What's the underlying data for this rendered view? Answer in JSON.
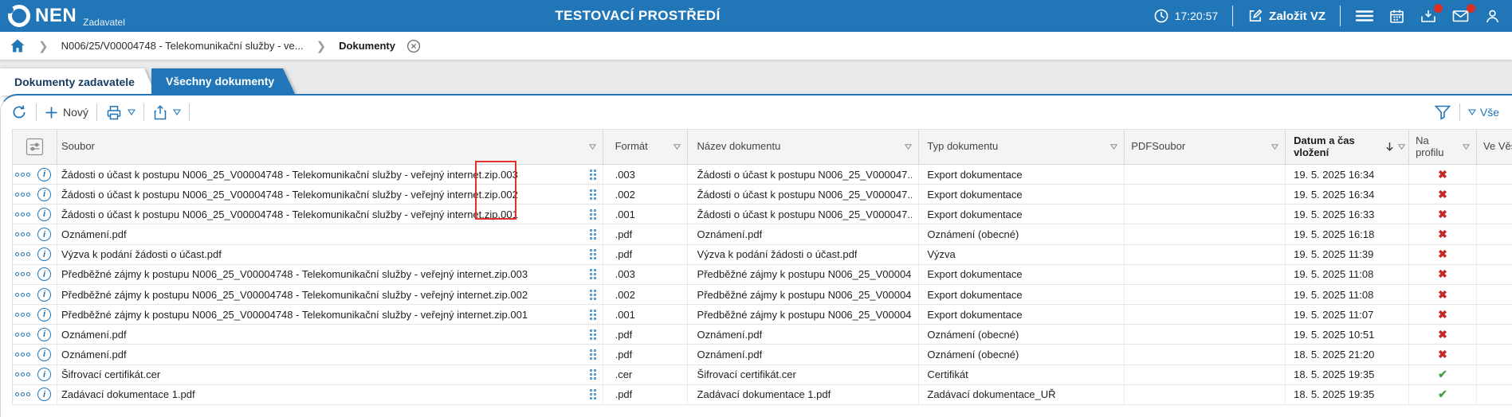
{
  "app": {
    "logo_text": "NEN",
    "logo_subtext": "Zadavatel",
    "environment_title": "TESTOVACÍ PROSTŘEDÍ",
    "time": "17:20:57",
    "create_vz_label": "Založit VZ"
  },
  "breadcrumb": {
    "procedure": "N006/25/V00004748 - Telekomunikační služby - ve...",
    "current": "Dokumenty"
  },
  "tabs": {
    "active": "Dokumenty zadavatele",
    "inactive": "Všechny dokumenty"
  },
  "toolbar": {
    "new_label": "Nový",
    "filter_all_label": "Vše"
  },
  "table": {
    "headers": {
      "soubor": "Soubor",
      "format": "Formát",
      "nazev": "Název dokumentu",
      "typ": "Typ dokumentu",
      "pdfsoubor": "PDFSoubor",
      "datum": "Datum a čas vložení",
      "na_profilu": "Na profilu",
      "ve_vestniku": "Ve Věst"
    },
    "rows": [
      {
        "soubor": "Žádosti o účast k postupu N006_25_V00004748 - Telekomunikační služby - veřejný internet.zip.003",
        "format": ".003",
        "nazev": "Žádosti o účast k postupu N006_25_V000047...",
        "typ": "Export dokumentace",
        "pdfsoubor": "",
        "datum": "19. 5. 2025 16:34",
        "na_profilu": "x-icon",
        "ve_vestniku": ""
      },
      {
        "soubor": "Žádosti o účast k postupu N006_25_V00004748 - Telekomunikační služby - veřejný internet.zip.002",
        "format": ".002",
        "nazev": "Žádosti o účast k postupu N006_25_V000047...",
        "typ": "Export dokumentace",
        "pdfsoubor": "",
        "datum": "19. 5. 2025 16:34",
        "na_profilu": "x-icon",
        "ve_vestniku": ""
      },
      {
        "soubor": "Žádosti o účast k postupu N006_25_V00004748 - Telekomunikační služby - veřejný internet.zip.001",
        "format": ".001",
        "nazev": "Žádosti o účast k postupu N006_25_V000047...",
        "typ": "Export dokumentace",
        "pdfsoubor": "",
        "datum": "19. 5. 2025 16:33",
        "na_profilu": "x-icon",
        "ve_vestniku": ""
      },
      {
        "soubor": "Oznámení.pdf",
        "format": ".pdf",
        "nazev": "Oznámení.pdf",
        "typ": "Oznámení (obecné)",
        "pdfsoubor": "",
        "datum": "19. 5. 2025 16:18",
        "na_profilu": "x-icon",
        "ve_vestniku": ""
      },
      {
        "soubor": "Výzva k podání žádosti o účast.pdf",
        "format": ".pdf",
        "nazev": "Výzva k podání žádosti o účast.pdf",
        "typ": "Výzva",
        "pdfsoubor": "",
        "datum": "19. 5. 2025 11:39",
        "na_profilu": "x-icon",
        "ve_vestniku": ""
      },
      {
        "soubor": "Předběžné zájmy k postupu N006_25_V00004748 - Telekomunikační služby - veřejný internet.zip.003",
        "format": ".003",
        "nazev": "Předběžné zájmy k postupu N006_25_V00004...",
        "typ": "Export dokumentace",
        "pdfsoubor": "",
        "datum": "19. 5. 2025 11:08",
        "na_profilu": "x-icon",
        "ve_vestniku": ""
      },
      {
        "soubor": "Předběžné zájmy k postupu N006_25_V00004748 - Telekomunikační služby - veřejný internet.zip.002",
        "format": ".002",
        "nazev": "Předběžné zájmy k postupu N006_25_V00004...",
        "typ": "Export dokumentace",
        "pdfsoubor": "",
        "datum": "19. 5. 2025 11:08",
        "na_profilu": "x-icon",
        "ve_vestniku": ""
      },
      {
        "soubor": "Předběžné zájmy k postupu N006_25_V00004748 - Telekomunikační služby - veřejný internet.zip.001",
        "format": ".001",
        "nazev": "Předběžné zájmy k postupu N006_25_V00004...",
        "typ": "Export dokumentace",
        "pdfsoubor": "",
        "datum": "19. 5. 2025 11:07",
        "na_profilu": "x-icon",
        "ve_vestniku": ""
      },
      {
        "soubor": "Oznámení.pdf",
        "format": ".pdf",
        "nazev": "Oznámení.pdf",
        "typ": "Oznámení (obecné)",
        "pdfsoubor": "",
        "datum": "19. 5. 2025 10:51",
        "na_profilu": "x-icon",
        "ve_vestniku": ""
      },
      {
        "soubor": "Oznámení.pdf",
        "format": ".pdf",
        "nazev": "Oznámení.pdf",
        "typ": "Oznámení (obecné)",
        "pdfsoubor": "",
        "datum": "18. 5. 2025 21:20",
        "na_profilu": "x-icon",
        "ve_vestniku": ""
      },
      {
        "soubor": "Šifrovací certifikát.cer",
        "format": ".cer",
        "nazev": "Šifrovací certifikát.cer",
        "typ": "Certifikát",
        "pdfsoubor": "",
        "datum": "18. 5. 2025 19:35",
        "na_profilu": "check-icon",
        "ve_vestniku": ""
      },
      {
        "soubor": "Zadávací dokumentace 1.pdf",
        "format": ".pdf",
        "nazev": "Zadávací dokumentace 1.pdf",
        "typ": "Zadávací dokumentace_UŘ",
        "pdfsoubor": "",
        "datum": "18. 5. 2025 19:35",
        "na_profilu": "check-icon",
        "ve_vestniku": ""
      }
    ]
  },
  "icons": {
    "na_profilu_true": "✔",
    "na_profilu_false": "✖"
  },
  "colors": {
    "accent": "#2176b8",
    "status_error": "#c62828",
    "status_ok": "#43a047",
    "annotation": "#e0312c",
    "badge": "#d93025"
  }
}
